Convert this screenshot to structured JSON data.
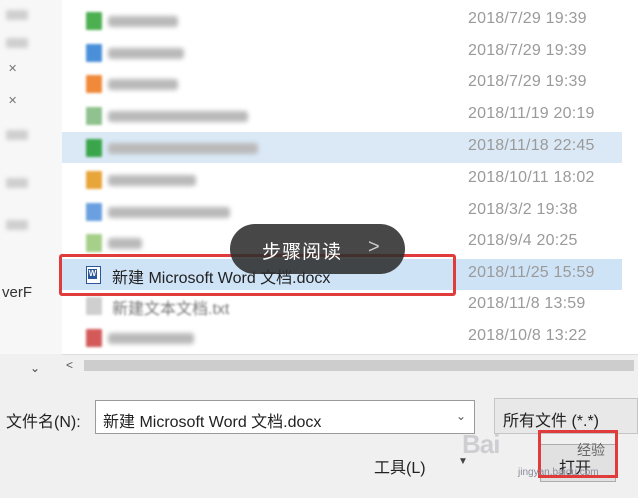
{
  "left_pane": {
    "truncated_label": "verF"
  },
  "file_list": {
    "rows": [
      {
        "date": "2018/7/29 19:39"
      },
      {
        "date": "2018/7/29 19:39"
      },
      {
        "date": "2018/7/29 19:39"
      },
      {
        "date": "2018/11/19 20:19"
      },
      {
        "date": "2018/11/18 22:45"
      },
      {
        "date": "2018/10/11 18:02"
      },
      {
        "date": "2018/3/2 19:38"
      },
      {
        "date": "2018/9/4 20:25"
      },
      {
        "name": "新建 Microsoft Word 文档.docx",
        "date": "2018/11/25 15:59"
      },
      {
        "name": "新建文本文档.txt",
        "date": "2018/11/8 13:59"
      },
      {
        "date": "2018/10/8 13:22"
      }
    ]
  },
  "overlay": {
    "text": "步骤阅读",
    "chevron": ">"
  },
  "bottom": {
    "filename_label": "文件名(N):",
    "filename_value": "新建 Microsoft Word 文档.docx",
    "filetype_value": "所有文件 (*.*)",
    "tools_label": "工具(L)",
    "open_label": "打开"
  },
  "watermark": {
    "mark": "Bai",
    "label": "经验",
    "sub": "jingyan.baidu.com"
  },
  "colors": {
    "highlight": "#e03c3c",
    "selected_row": "#cfe3f7",
    "hover_row": "#dbe9f6",
    "date_text": "#9a9a9a"
  },
  "icons": [
    "pin-icon",
    "word-doc-icon",
    "dropdown-arrow-icon",
    "scroll-left-icon",
    "chevron-right-icon"
  ]
}
